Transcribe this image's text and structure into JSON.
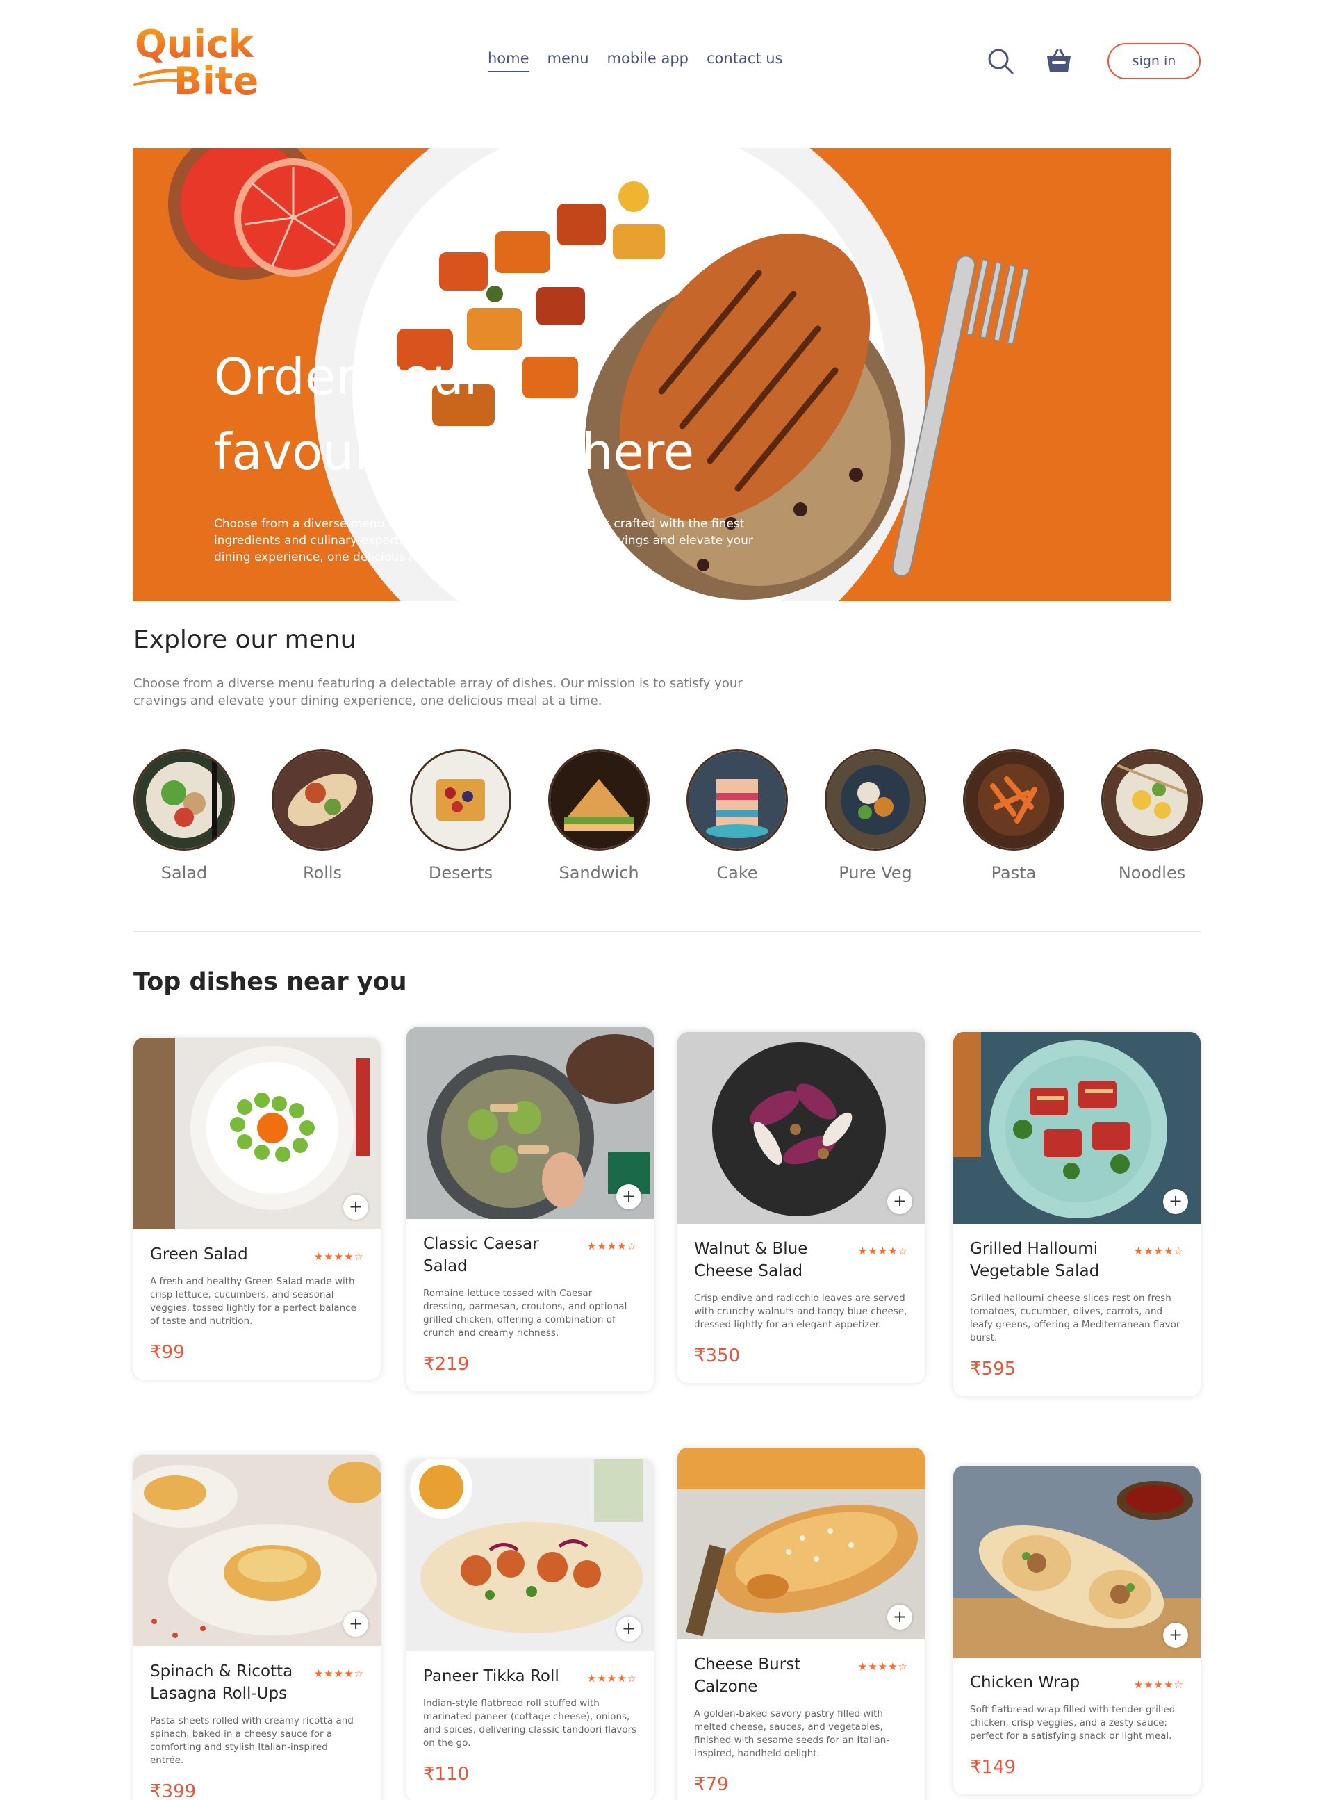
{
  "brand": {
    "logo_line1": "Quick",
    "logo_line2": "Bite"
  },
  "nav": {
    "items": [
      {
        "label": "home",
        "active": true
      },
      {
        "label": "menu",
        "active": false
      },
      {
        "label": "mobile app",
        "active": false
      },
      {
        "label": "contact us",
        "active": false
      }
    ],
    "signin_label": "sign in",
    "icons": {
      "search": "search-icon",
      "basket": "basket-icon"
    }
  },
  "hero": {
    "title_line1": "Order your",
    "title_line2": "favourite food here",
    "text": "Choose from a diverse menu featuring a delectable array of dishes crafted with the finest ingredients and culinary expertise. Our mission is to satisfy your cravings and elevate your dining experience, one delicious meal at a time."
  },
  "explore": {
    "title": "Explore our menu",
    "text": "Choose from a diverse menu featuring a delectable array of dishes. Our mission is to satisfy your cravings and elevate your dining experience, one delicious meal at a time.",
    "items": [
      {
        "label": "Salad"
      },
      {
        "label": "Rolls"
      },
      {
        "label": "Deserts"
      },
      {
        "label": "Sandwich"
      },
      {
        "label": "Cake"
      },
      {
        "label": "Pure Veg"
      },
      {
        "label": "Pasta"
      },
      {
        "label": "Noodles"
      }
    ]
  },
  "dishes": {
    "title": "Top dishes near you",
    "add_label": "+",
    "rating_stars": "★★★★☆",
    "items": [
      {
        "name": "Green Salad",
        "desc": "A fresh and healthy Green Salad made with crisp lettuce, cucumbers, and seasonal veggies, tossed lightly for a perfect balance of taste and nutrition.",
        "price": "₹99"
      },
      {
        "name": "Classic Caesar Salad",
        "desc": "Romaine lettuce tossed with Caesar dressing, parmesan, croutons, and optional grilled chicken, offering a combination of crunch and creamy richness.",
        "price": "₹219"
      },
      {
        "name": "Walnut & Blue Cheese Salad",
        "desc": "Crisp endive and radicchio leaves are served with crunchy walnuts and tangy blue cheese, dressed lightly for an elegant appetizer.",
        "price": "₹350"
      },
      {
        "name": "Grilled Halloumi Vegetable Salad",
        "desc": "Grilled halloumi cheese slices rest on fresh tomatoes, cucumber, olives, carrots, and leafy greens, offering a Mediterranean flavor burst.",
        "price": "₹595"
      },
      {
        "name": "Spinach & Ricotta Lasagna Roll-Ups",
        "desc": "Pasta sheets rolled with creamy ricotta and spinach, baked in a cheesy sauce for a comforting and stylish Italian-inspired entrée.",
        "price": "₹399"
      },
      {
        "name": "Paneer Tikka Roll",
        "desc": "Indian-style flatbread roll stuffed with marinated paneer (cottage cheese), onions, and spices, delivering classic tandoori flavors on the go.",
        "price": "₹110"
      },
      {
        "name": "Cheese Burst Calzone",
        "desc": "A golden-baked savory pastry filled with melted cheese, sauces, and vegetables, finished with sesame seeds for an Italian-inspired, handheld delight.",
        "price": "₹79"
      },
      {
        "name": "Chicken Wrap",
        "desc": "Soft flatbread wrap filled with tender grilled chicken, crisp veggies, and a zesty sauce; perfect for a satisfying snack or light meal.",
        "price": "₹149"
      }
    ]
  },
  "colors": {
    "accent": "#e9573a",
    "nav_text": "#49557e",
    "hero_bg": "#e6701c",
    "star": "#ff6a2b"
  }
}
